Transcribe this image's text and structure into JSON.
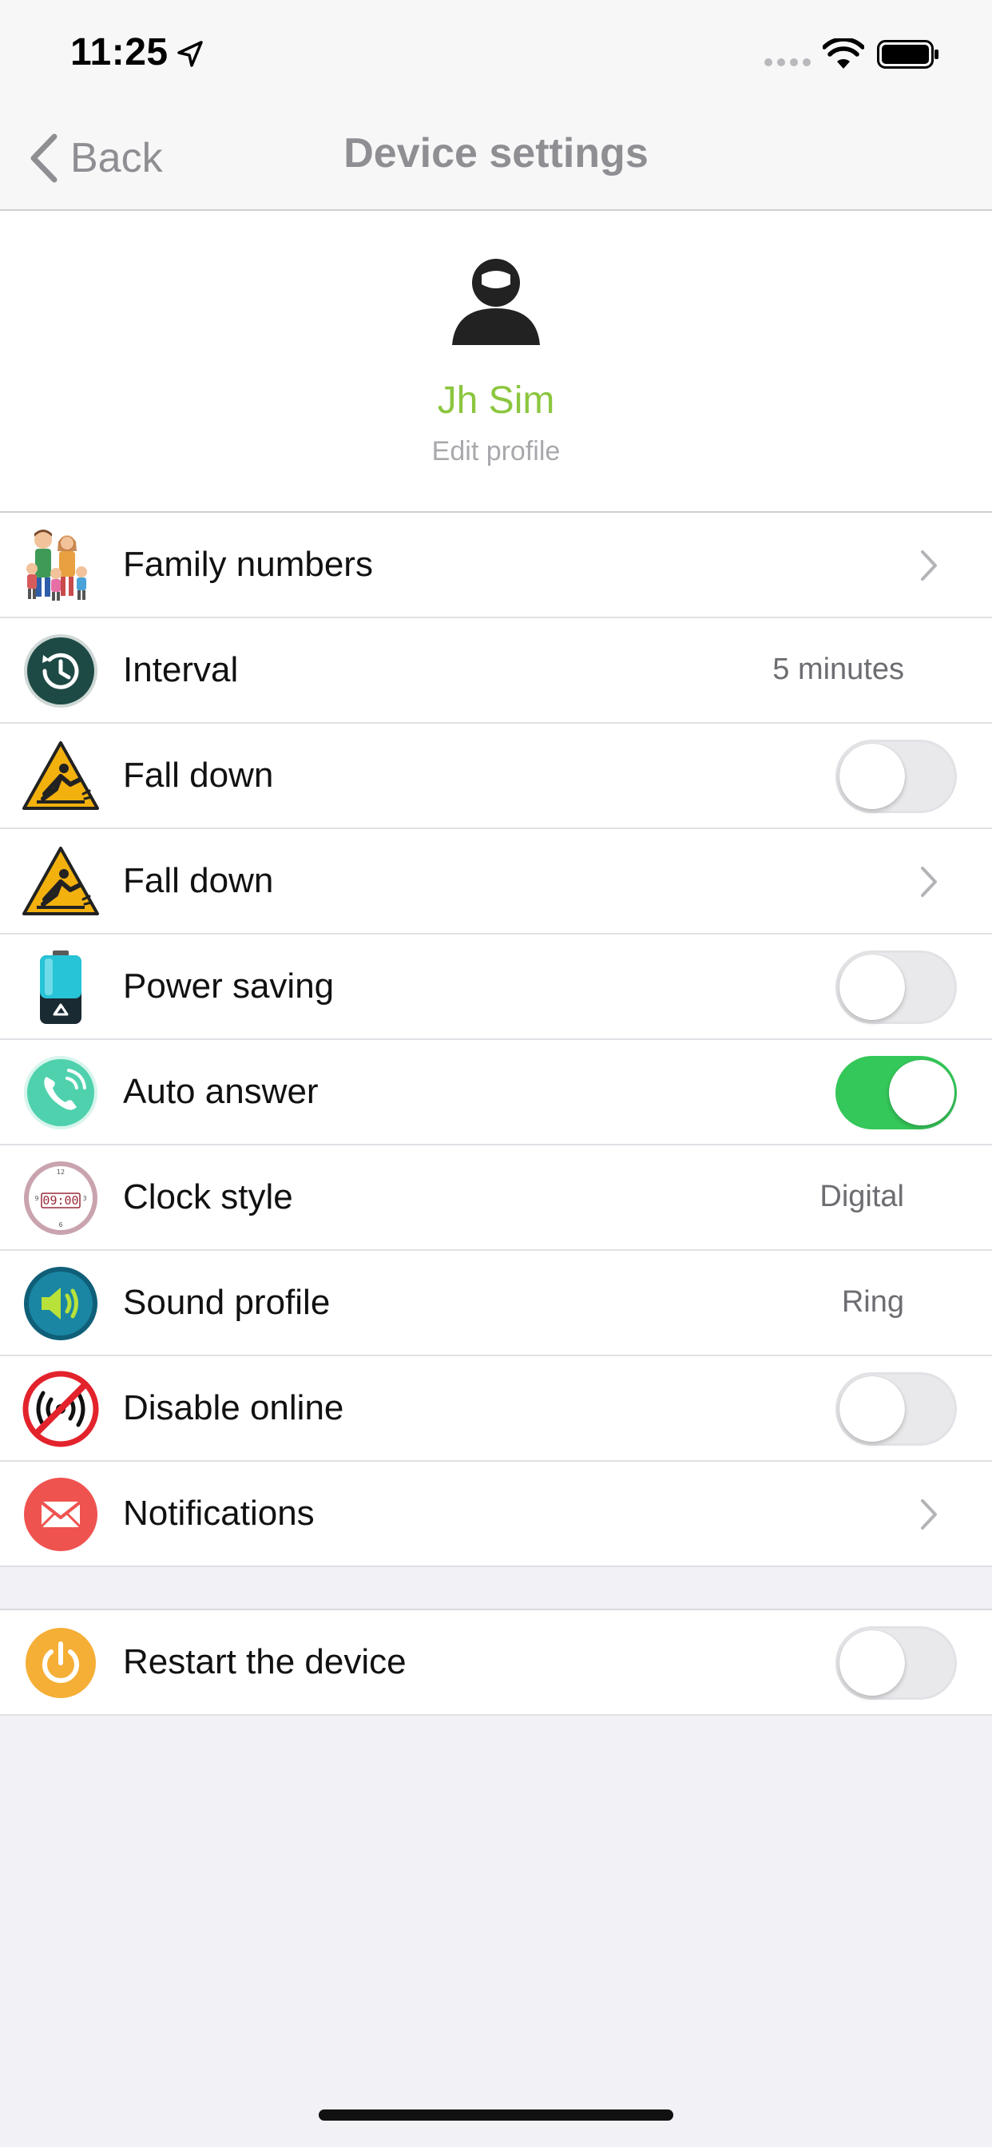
{
  "status_bar": {
    "time": "11:25"
  },
  "nav": {
    "back_label": "Back",
    "title": "Device settings"
  },
  "profile": {
    "name": "Jh Sim",
    "edit_label": "Edit profile"
  },
  "settings": [
    {
      "label": "Family numbers",
      "control": "chevron",
      "icon": "family-icon"
    },
    {
      "label": "Interval",
      "control": "value",
      "value": "5 minutes",
      "icon": "history-clock-icon"
    },
    {
      "label": "Fall down",
      "control": "toggle",
      "on": false,
      "icon": "fall-warning-icon"
    },
    {
      "label": "Fall down",
      "control": "chevron",
      "icon": "fall-warning-icon"
    },
    {
      "label": "Power saving",
      "control": "toggle",
      "on": false,
      "icon": "battery-icon"
    },
    {
      "label": "Auto answer",
      "control": "toggle",
      "on": true,
      "icon": "phone-icon"
    },
    {
      "label": "Clock style",
      "control": "value",
      "value": "Digital",
      "icon": "clock-icon"
    },
    {
      "label": "Sound profile",
      "control": "value",
      "value": "Ring",
      "icon": "speaker-icon"
    },
    {
      "label": "Disable online",
      "control": "toggle",
      "on": false,
      "icon": "no-signal-icon"
    },
    {
      "label": "Notifications",
      "control": "chevron",
      "icon": "mail-icon"
    }
  ],
  "restart": {
    "label": "Restart the device",
    "control": "toggle",
    "on": false,
    "icon": "power-icon"
  },
  "colors": {
    "accent_green": "#8cc63f",
    "toggle_on": "#34c759",
    "toggle_off": "#e9e9eb",
    "background": "#f2f2f6"
  }
}
